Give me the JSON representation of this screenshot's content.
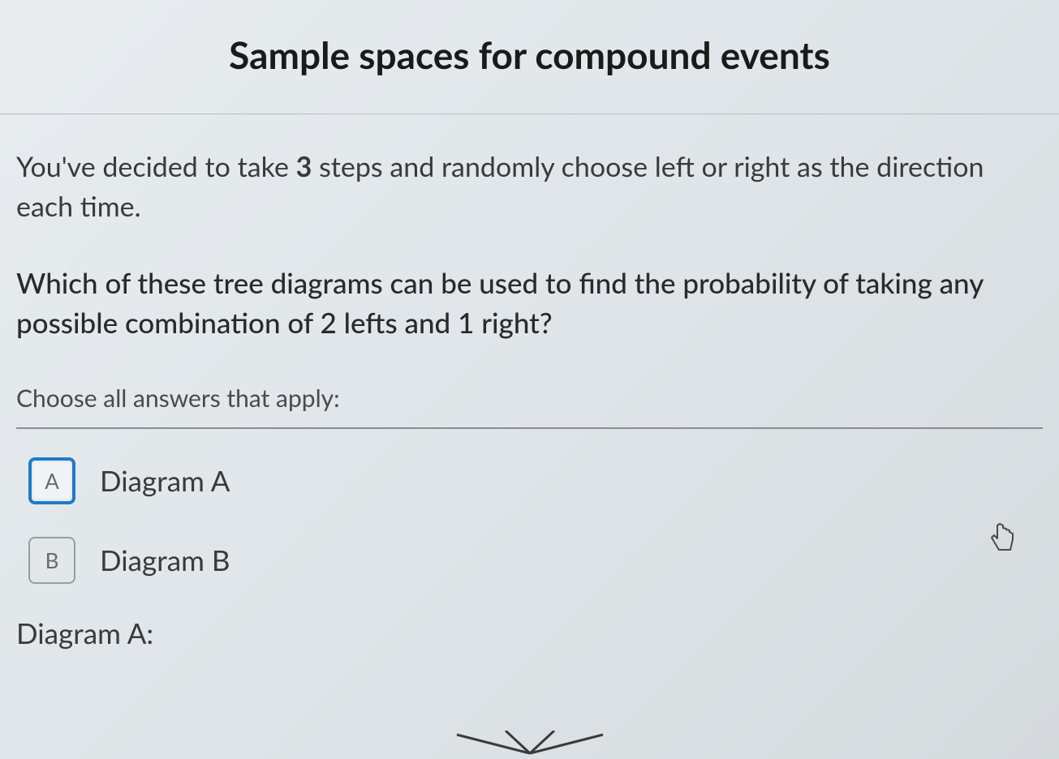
{
  "title": "Sample spaces for compound events",
  "problem": {
    "prefix": "You've decided to take ",
    "steps": "3",
    "suffix": " steps and randomly choose left or right as the direction each time."
  },
  "question": {
    "prefix": "Which of these tree diagrams can be used to find the probability of taking any possible combination of ",
    "lefts_bold": "2",
    "mid1": " lefts and ",
    "rights_bold": "1",
    "mid2": " right?"
  },
  "instruction": "Choose all answers that apply:",
  "options": {
    "a": {
      "key": "A",
      "label": "Diagram A",
      "selected": true
    },
    "b": {
      "key": "B",
      "label": "Diagram B",
      "selected": false
    }
  },
  "diagram_heading": "Diagram A:"
}
